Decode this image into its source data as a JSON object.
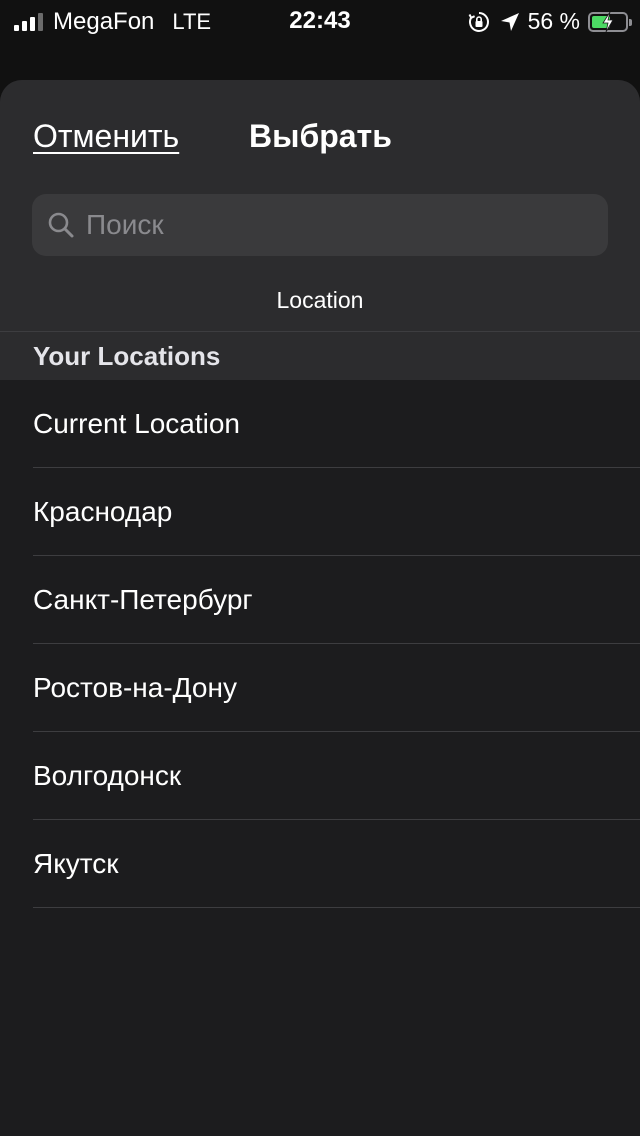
{
  "status_bar": {
    "carrier": "MegaFon",
    "network": "LTE",
    "time": "22:43",
    "battery_percent": "56 %",
    "battery_level": 0.56,
    "signal_bars": 3,
    "icons": [
      "orientation-lock-icon",
      "location-arrow-icon",
      "battery-charging-icon"
    ]
  },
  "sheet": {
    "cancel_label": "Отменить",
    "title": "Выбрать",
    "search": {
      "placeholder": "Поиск",
      "value": ""
    },
    "section_label": "Location"
  },
  "locations": {
    "header": "Your Locations",
    "items": [
      {
        "label": "Current Location"
      },
      {
        "label": "Краснодар"
      },
      {
        "label": "Санкт-Петербург"
      },
      {
        "label": "Ростов-на-Дону"
      },
      {
        "label": "Волгодонск"
      },
      {
        "label": "Якутск"
      }
    ]
  },
  "colors": {
    "background": "#111111",
    "sheet": "#1c1c1e",
    "header": "#2c2c2e",
    "search_field": "#3a3a3c",
    "battery_fill": "#4cd964"
  }
}
